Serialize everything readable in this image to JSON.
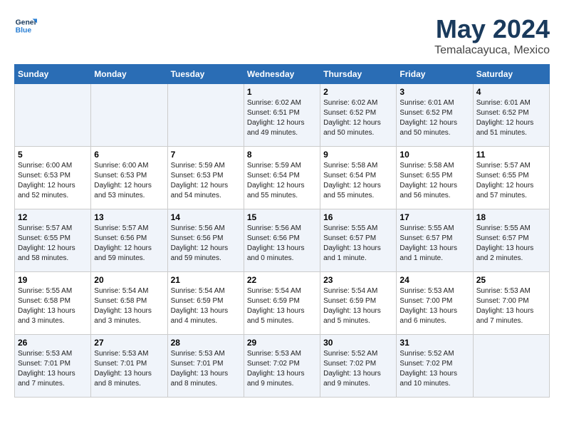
{
  "logo": {
    "line1": "General",
    "line2": "Blue"
  },
  "title": "May 2024",
  "location": "Temalacayuca, Mexico",
  "days_of_week": [
    "Sunday",
    "Monday",
    "Tuesday",
    "Wednesday",
    "Thursday",
    "Friday",
    "Saturday"
  ],
  "weeks": [
    [
      {
        "day": "",
        "info": ""
      },
      {
        "day": "",
        "info": ""
      },
      {
        "day": "",
        "info": ""
      },
      {
        "day": "1",
        "info": "Sunrise: 6:02 AM\nSunset: 6:51 PM\nDaylight: 12 hours\nand 49 minutes."
      },
      {
        "day": "2",
        "info": "Sunrise: 6:02 AM\nSunset: 6:52 PM\nDaylight: 12 hours\nand 50 minutes."
      },
      {
        "day": "3",
        "info": "Sunrise: 6:01 AM\nSunset: 6:52 PM\nDaylight: 12 hours\nand 50 minutes."
      },
      {
        "day": "4",
        "info": "Sunrise: 6:01 AM\nSunset: 6:52 PM\nDaylight: 12 hours\nand 51 minutes."
      }
    ],
    [
      {
        "day": "5",
        "info": "Sunrise: 6:00 AM\nSunset: 6:53 PM\nDaylight: 12 hours\nand 52 minutes."
      },
      {
        "day": "6",
        "info": "Sunrise: 6:00 AM\nSunset: 6:53 PM\nDaylight: 12 hours\nand 53 minutes."
      },
      {
        "day": "7",
        "info": "Sunrise: 5:59 AM\nSunset: 6:53 PM\nDaylight: 12 hours\nand 54 minutes."
      },
      {
        "day": "8",
        "info": "Sunrise: 5:59 AM\nSunset: 6:54 PM\nDaylight: 12 hours\nand 55 minutes."
      },
      {
        "day": "9",
        "info": "Sunrise: 5:58 AM\nSunset: 6:54 PM\nDaylight: 12 hours\nand 55 minutes."
      },
      {
        "day": "10",
        "info": "Sunrise: 5:58 AM\nSunset: 6:55 PM\nDaylight: 12 hours\nand 56 minutes."
      },
      {
        "day": "11",
        "info": "Sunrise: 5:57 AM\nSunset: 6:55 PM\nDaylight: 12 hours\nand 57 minutes."
      }
    ],
    [
      {
        "day": "12",
        "info": "Sunrise: 5:57 AM\nSunset: 6:55 PM\nDaylight: 12 hours\nand 58 minutes."
      },
      {
        "day": "13",
        "info": "Sunrise: 5:57 AM\nSunset: 6:56 PM\nDaylight: 12 hours\nand 59 minutes."
      },
      {
        "day": "14",
        "info": "Sunrise: 5:56 AM\nSunset: 6:56 PM\nDaylight: 12 hours\nand 59 minutes."
      },
      {
        "day": "15",
        "info": "Sunrise: 5:56 AM\nSunset: 6:56 PM\nDaylight: 13 hours\nand 0 minutes."
      },
      {
        "day": "16",
        "info": "Sunrise: 5:55 AM\nSunset: 6:57 PM\nDaylight: 13 hours\nand 1 minute."
      },
      {
        "day": "17",
        "info": "Sunrise: 5:55 AM\nSunset: 6:57 PM\nDaylight: 13 hours\nand 1 minute."
      },
      {
        "day": "18",
        "info": "Sunrise: 5:55 AM\nSunset: 6:57 PM\nDaylight: 13 hours\nand 2 minutes."
      }
    ],
    [
      {
        "day": "19",
        "info": "Sunrise: 5:55 AM\nSunset: 6:58 PM\nDaylight: 13 hours\nand 3 minutes."
      },
      {
        "day": "20",
        "info": "Sunrise: 5:54 AM\nSunset: 6:58 PM\nDaylight: 13 hours\nand 3 minutes."
      },
      {
        "day": "21",
        "info": "Sunrise: 5:54 AM\nSunset: 6:59 PM\nDaylight: 13 hours\nand 4 minutes."
      },
      {
        "day": "22",
        "info": "Sunrise: 5:54 AM\nSunset: 6:59 PM\nDaylight: 13 hours\nand 5 minutes."
      },
      {
        "day": "23",
        "info": "Sunrise: 5:54 AM\nSunset: 6:59 PM\nDaylight: 13 hours\nand 5 minutes."
      },
      {
        "day": "24",
        "info": "Sunrise: 5:53 AM\nSunset: 7:00 PM\nDaylight: 13 hours\nand 6 minutes."
      },
      {
        "day": "25",
        "info": "Sunrise: 5:53 AM\nSunset: 7:00 PM\nDaylight: 13 hours\nand 7 minutes."
      }
    ],
    [
      {
        "day": "26",
        "info": "Sunrise: 5:53 AM\nSunset: 7:01 PM\nDaylight: 13 hours\nand 7 minutes."
      },
      {
        "day": "27",
        "info": "Sunrise: 5:53 AM\nSunset: 7:01 PM\nDaylight: 13 hours\nand 8 minutes."
      },
      {
        "day": "28",
        "info": "Sunrise: 5:53 AM\nSunset: 7:01 PM\nDaylight: 13 hours\nand 8 minutes."
      },
      {
        "day": "29",
        "info": "Sunrise: 5:53 AM\nSunset: 7:02 PM\nDaylight: 13 hours\nand 9 minutes."
      },
      {
        "day": "30",
        "info": "Sunrise: 5:52 AM\nSunset: 7:02 PM\nDaylight: 13 hours\nand 9 minutes."
      },
      {
        "day": "31",
        "info": "Sunrise: 5:52 AM\nSunset: 7:02 PM\nDaylight: 13 hours\nand 10 minutes."
      },
      {
        "day": "",
        "info": ""
      }
    ]
  ]
}
